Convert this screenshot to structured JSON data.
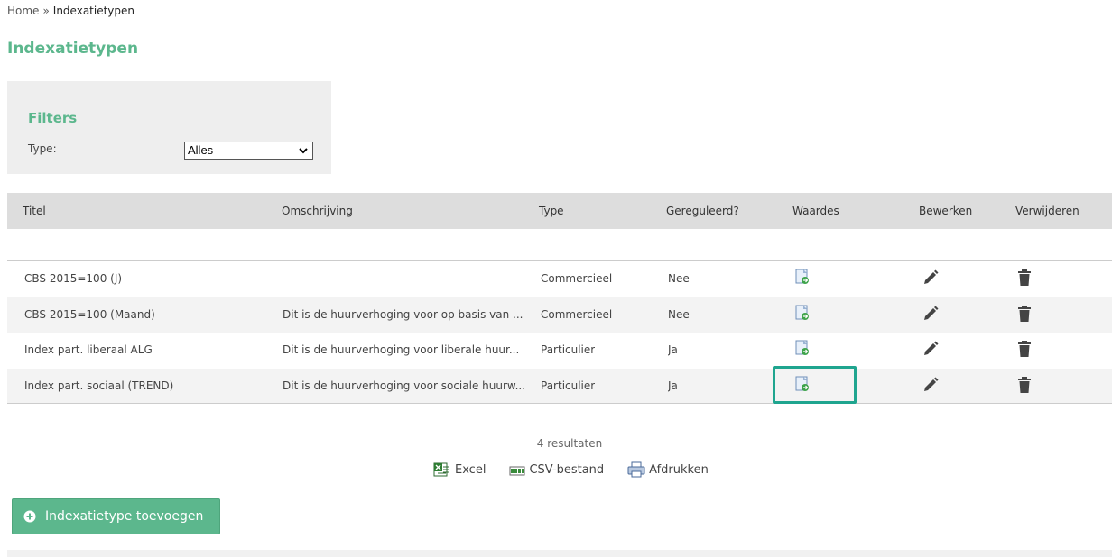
{
  "breadcrumb": {
    "home": "Home",
    "separator": "»",
    "current": "Indexatietypen"
  },
  "page": {
    "title": "Indexatietypen"
  },
  "filters": {
    "title": "Filters",
    "type_label": "Type:",
    "type_value": "Alles"
  },
  "table": {
    "columns": [
      "Titel",
      "Omschrijving",
      "Type",
      "Gereguleerd?",
      "Waardes",
      "Bewerken",
      "Verwijderen"
    ],
    "rows": [
      {
        "titel": "CBS 2015=100 (J)",
        "omschrijving": "",
        "type": "Commercieel",
        "gereguleerd": "Nee"
      },
      {
        "titel": "CBS 2015=100 (Maand)",
        "omschrijving": "Dit is de huurverhoging voor op basis van ...",
        "type": "Commercieel",
        "gereguleerd": "Nee"
      },
      {
        "titel": "Index part. liberaal ALG",
        "omschrijving": "Dit is de huurverhoging voor liberale huur...",
        "type": "Particulier",
        "gereguleerd": "Ja"
      },
      {
        "titel": "Index part. sociaal (TREND)",
        "omschrijving": "Dit is de huurverhoging voor sociale huurw...",
        "type": "Particulier",
        "gereguleerd": "Ja"
      }
    ]
  },
  "results": {
    "count_text": "4 resultaten"
  },
  "exports": {
    "excel": "Excel",
    "csv": "CSV-bestand",
    "print": "Afdrukken"
  },
  "actions": {
    "add_label": "Indexatietype toevoegen"
  },
  "colors": {
    "accent": "#5cb78d",
    "highlight": "#1fa58f",
    "header_bg": "#dddddd",
    "filter_bg": "#eeeeee"
  }
}
